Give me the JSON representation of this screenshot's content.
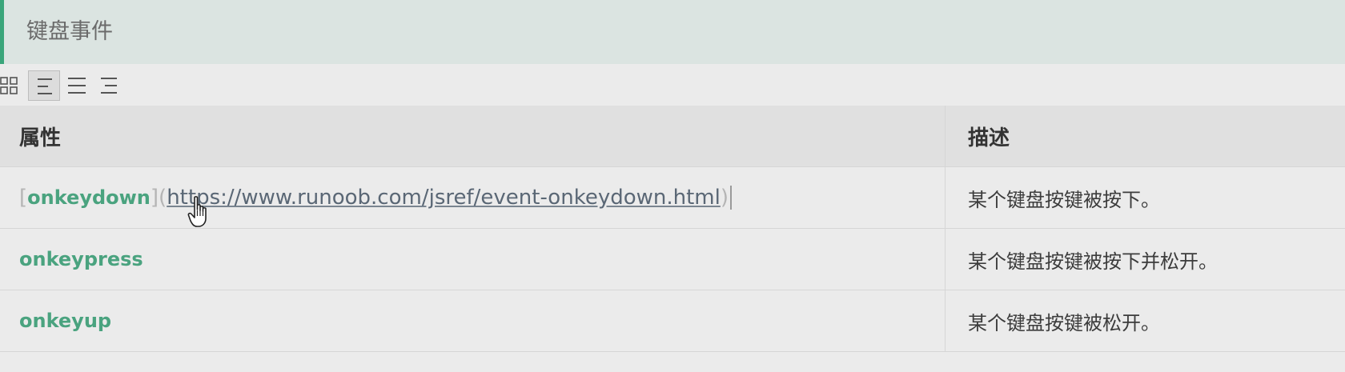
{
  "heading": {
    "title": "键盘事件"
  },
  "toolbar": {
    "buttons": [
      {
        "icon": "table-grid-icon",
        "active": false
      },
      {
        "icon": "align-left-icon",
        "active": true
      },
      {
        "icon": "align-center-icon",
        "active": false
      },
      {
        "icon": "align-right-icon",
        "active": false
      }
    ]
  },
  "table": {
    "headers": [
      "属性",
      "描述"
    ],
    "rows": [
      {
        "open_bracket": "[",
        "property": "onkeydown",
        "close_bracket": "](",
        "url": "https://www.runoob.com/jsref/event-onkeydown.html",
        "end_paren": ")",
        "description": "某个键盘按键被按下。"
      },
      {
        "property": "onkeypress",
        "description": "某个键盘按键被按下并松开。"
      },
      {
        "property": "onkeyup",
        "description": "某个键盘按键被松开。"
      }
    ]
  },
  "colors": {
    "accent": "#3aa57a",
    "property_text": "#4aa37f",
    "heading_bg": "#dbe4e1"
  }
}
